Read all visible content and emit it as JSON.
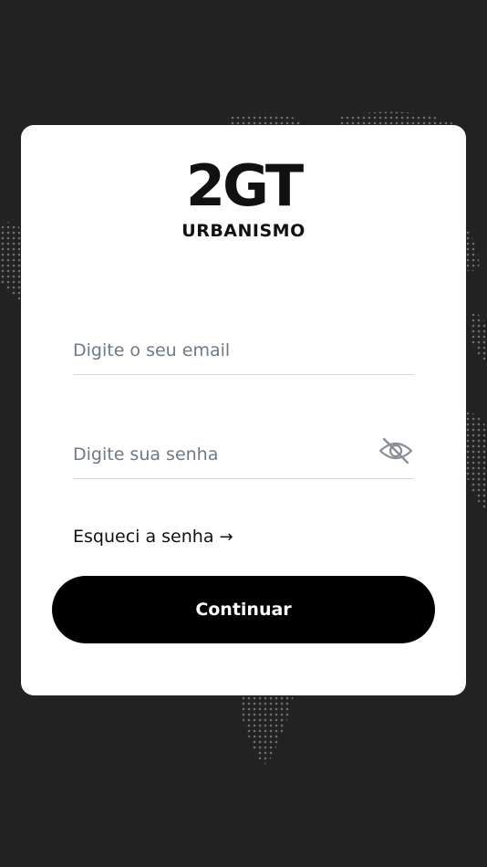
{
  "brand": {
    "main": "2GT",
    "sub": "URBANISMO"
  },
  "form": {
    "email_placeholder": "Digite o seu email",
    "password_placeholder": "Digite sua senha",
    "password_toggle_icon": "eye-slash-icon",
    "forgot_label": "Esqueci a senha",
    "forgot_icon": "arrow-right-icon",
    "submit_label": "Continuar"
  },
  "colors": {
    "background": "#222222",
    "card": "#ffffff",
    "button": "#000000",
    "button_text": "#ffffff",
    "placeholder": "#6e7a85"
  }
}
